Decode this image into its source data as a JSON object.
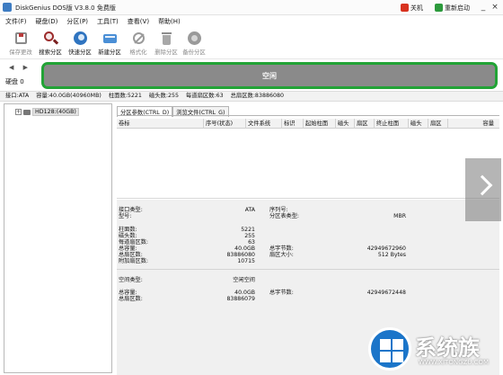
{
  "window": {
    "title": "DiskGenius DOS版 V3.8.0 免费版",
    "shutdown_label": "关机",
    "restart_label": "重新启动",
    "minimize": "_",
    "close": "×"
  },
  "menu": [
    "文件(F)",
    "硬盘(D)",
    "分区(P)",
    "工具(T)",
    "查看(V)",
    "帮助(H)"
  ],
  "toolbar": [
    {
      "label": "保存更改",
      "icon": "save-disk-icon",
      "enabled": false
    },
    {
      "label": "搜索分区",
      "icon": "magnifier-icon",
      "enabled": true
    },
    {
      "label": "快速分区",
      "icon": "quick-partition-icon",
      "enabled": true
    },
    {
      "label": "新建分区",
      "icon": "new-partition-icon",
      "enabled": true
    },
    {
      "label": "格式化",
      "icon": "format-icon",
      "enabled": false
    },
    {
      "label": "删除分区",
      "icon": "trash-icon",
      "enabled": false
    },
    {
      "label": "备份分区",
      "icon": "backup-icon",
      "enabled": false
    }
  ],
  "disk_bar": {
    "nav": "◀ ▶",
    "disk_label": "硬盘 0",
    "visual_label": "空闲",
    "bar_color": "#22a336"
  },
  "disk_info": {
    "interface": "接口:ATA",
    "capacity": "容量:40.0GB(40960MB)",
    "cylinders": "柱面数:5221",
    "heads": "磁头数:255",
    "sectors_per_track": "每道扇区数:63",
    "total_sectors": "总扇区数:83886080"
  },
  "tree": {
    "item": "HD128:(40GB)"
  },
  "tabs": [
    "分区参数(CTRL_D)",
    "浏览文件(CTRL_G)"
  ],
  "table_columns": [
    "卷标",
    "序号(状态)",
    "文件系统",
    "标识",
    "起始柱面",
    "磁头",
    "扇区",
    "终止柱面",
    "磁头",
    "扇区",
    "容量"
  ],
  "props": {
    "interface_type_label": "接口类型:",
    "interface_type_value": "ATA",
    "serial_label": "序列号:",
    "model_label": "型号:",
    "ptable_label": "分区表类型:",
    "ptable_value": "MBR",
    "cylinders_label": "柱面数:",
    "cylinders_value": "5221",
    "heads_label": "磁头数:",
    "heads_value": "255",
    "spt_label": "每道扇区数:",
    "spt_value": "63",
    "capacity_label": "总容量:",
    "capacity_value": "40.0GB",
    "bytes_label": "总字节数:",
    "bytes_value": "42949672960",
    "sectors_label": "总扇区数:",
    "sectors_value": "83886080",
    "sector_size_label": "扇区大小:",
    "sector_size_value": "512 Bytes",
    "extra_label": "附加扇区数:",
    "extra_value": "10715",
    "space_type_label": "空间类型:",
    "space_type_value": "空闲空间",
    "free_capacity_label": "总容量:",
    "free_capacity_value": "40.0GB",
    "free_bytes_label": "总字节数:",
    "free_bytes_value": "42949672448",
    "free_sectors_label": "总扇区数:",
    "free_sectors_value": "83886079"
  },
  "watermark": {
    "text": "系统族",
    "url": "WWW.XITONGZU.COM"
  }
}
